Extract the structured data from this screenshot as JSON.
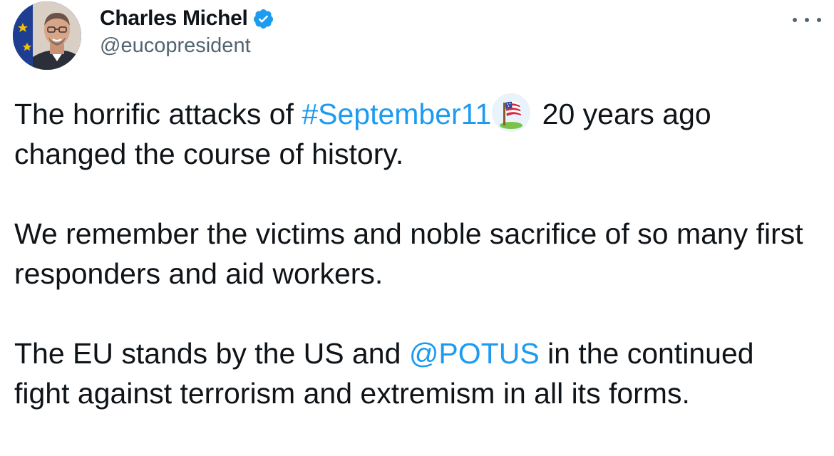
{
  "author": {
    "display_name": "Charles Michel",
    "handle": "@eucopresident",
    "verified": true,
    "avatar_icon": "profile-photo"
  },
  "menu": {
    "icon": "more-horizontal-icon"
  },
  "tweet": {
    "p1": {
      "before": "The horrific attacks of ",
      "hashtag": "#September11",
      "hashflag_icon": "us-flag-hashflag",
      "after": " 20 years ago changed the course of history."
    },
    "p2": {
      "text": "We remember the victims and noble sacrifice of so many first responders and aid workers."
    },
    "p3": {
      "before": "The EU stands by the US and ",
      "mention": "@POTUS",
      "after": " in the continued fight against terrorism and extremism in all its forms."
    }
  },
  "colors": {
    "link": "#1d9bf0",
    "text": "#0f1419",
    "secondary": "#536471",
    "verified": "#1d9bf0"
  }
}
